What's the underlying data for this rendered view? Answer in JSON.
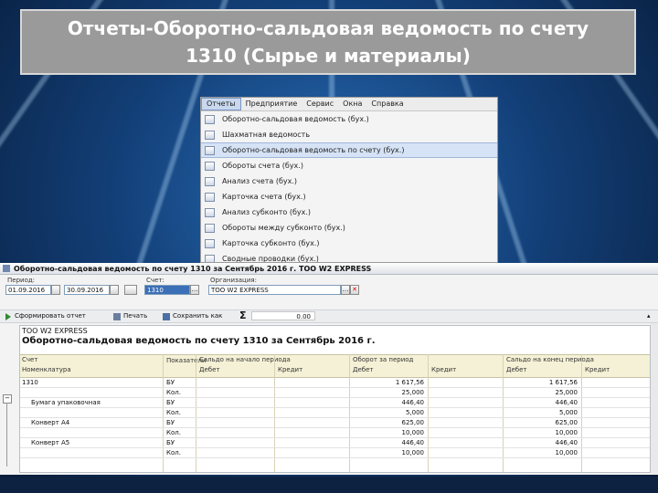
{
  "slide": {
    "title": "Отчеты-Оборотно-сальдовая ведомость по счету 1310 (Сырье и материалы)"
  },
  "menu": {
    "bar": [
      "Отчеты",
      "Предприятие",
      "Сервис",
      "Окна",
      "Справка"
    ],
    "items": [
      {
        "label": "Оборотно-сальдовая ведомость (бух.)",
        "highlighted": false
      },
      {
        "label": "Шахматная ведомость",
        "highlighted": false
      },
      {
        "label": "Оборотно-сальдовая ведомость по счету (бух.)",
        "highlighted": true
      },
      {
        "label": "Обороты счета (бух.)",
        "highlighted": false
      },
      {
        "label": "Анализ счета (бух.)",
        "highlighted": false
      },
      {
        "label": "Карточка счета (бух.)",
        "highlighted": false
      },
      {
        "label": "Анализ субконто (бух.)",
        "highlighted": false
      },
      {
        "label": "Обороты между субконто (бух.)",
        "highlighted": false
      },
      {
        "label": "Карточка субконто (бух.)",
        "highlighted": false
      },
      {
        "label": "Сводные проводки (бух.)",
        "highlighted": false
      }
    ]
  },
  "window": {
    "title": "Оборотно-сальдовая ведомость по счету 1310 за Сентябрь 2016 г. TOO W2 EXPRESS",
    "period_label": "Период:",
    "date_from": "01.09.2016",
    "date_to": "30.09.2016",
    "account_label": "Счет:",
    "account_value": "1310",
    "org_label": "Организация:",
    "org_value": "TOO W2 EXPRESS",
    "toolbar": {
      "generate": "Сформировать отчет",
      "print": "Печать",
      "save": "Сохранить как",
      "sum_value": "0.00"
    }
  },
  "report": {
    "company": "TOO W2 EXPRESS",
    "title": "Оборотно-сальдовая ведомость по счету 1310 за Сентябрь 2016 г.",
    "headers": {
      "account": "Счет",
      "nomenclature": "Номенклатура",
      "indicators": "Показатели",
      "opening": "Сальдо на начало периода",
      "turnover": "Оборот за период",
      "closing": "Сальдо на конец периода",
      "debit": "Дебет",
      "credit": "Кредит"
    },
    "rows": [
      {
        "name": "1310",
        "indicator": "БУ",
        "turn_debit": "1 617,56",
        "close_debit": "1 617,56"
      },
      {
        "name": "",
        "indicator": "Кол.",
        "turn_debit": "25,000",
        "close_debit": "25,000"
      },
      {
        "name": "Бумага упаковочная",
        "indicator": "БУ",
        "turn_debit": "446,40",
        "close_debit": "446,40"
      },
      {
        "name": "",
        "indicator": "Кол.",
        "turn_debit": "5,000",
        "close_debit": "5,000"
      },
      {
        "name": "Конверт А4",
        "indicator": "БУ",
        "turn_debit": "625,00",
        "close_debit": "625,00"
      },
      {
        "name": "",
        "indicator": "Кол.",
        "turn_debit": "10,000",
        "close_debit": "10,000"
      },
      {
        "name": "Конверт А5",
        "indicator": "БУ",
        "turn_debit": "446,40",
        "close_debit": "446,40"
      },
      {
        "name": "",
        "indicator": "Кол.",
        "turn_debit": "10,000",
        "close_debit": "10,000"
      }
    ]
  }
}
